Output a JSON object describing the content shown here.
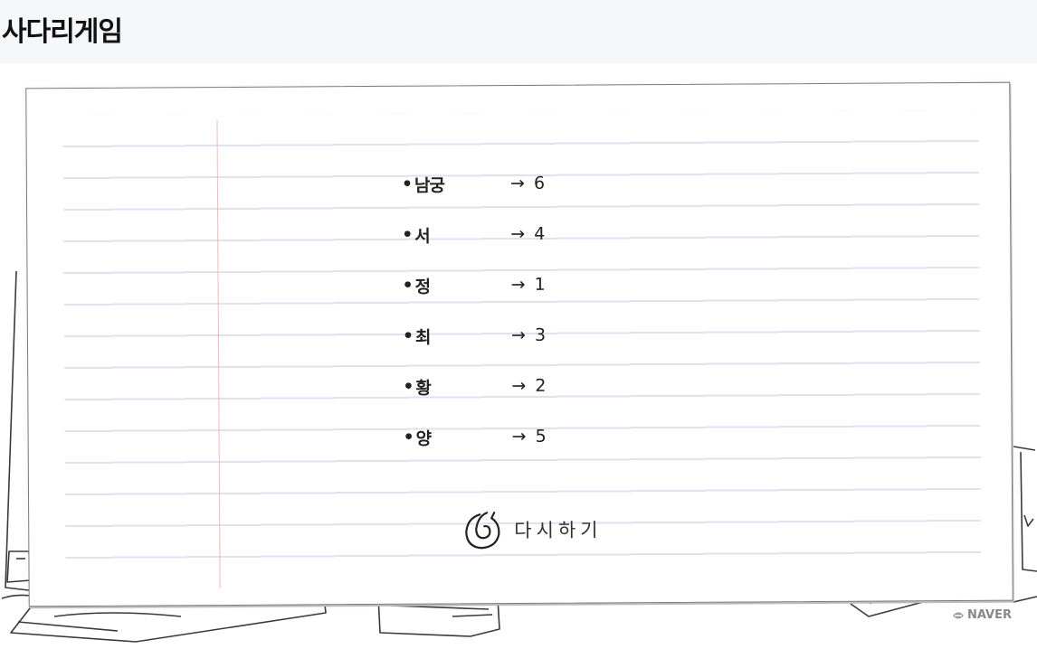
{
  "page": {
    "title": "사다리게임"
  },
  "results": [
    {
      "name": "남궁",
      "arrow": "→",
      "number": "6"
    },
    {
      "name": "서",
      "arrow": "→",
      "number": "4"
    },
    {
      "name": "정",
      "arrow": "→",
      "number": "1"
    },
    {
      "name": "최",
      "arrow": "→",
      "number": "3"
    },
    {
      "name": "황",
      "arrow": "→",
      "number": "2"
    },
    {
      "name": "양",
      "arrow": "→",
      "number": "5"
    }
  ],
  "bullet": "•",
  "retry": {
    "label": "다시하기",
    "icon": "retry-swirl-icon"
  },
  "footer": {
    "logo": "NAVER",
    "icon": "naver-mark-icon"
  }
}
